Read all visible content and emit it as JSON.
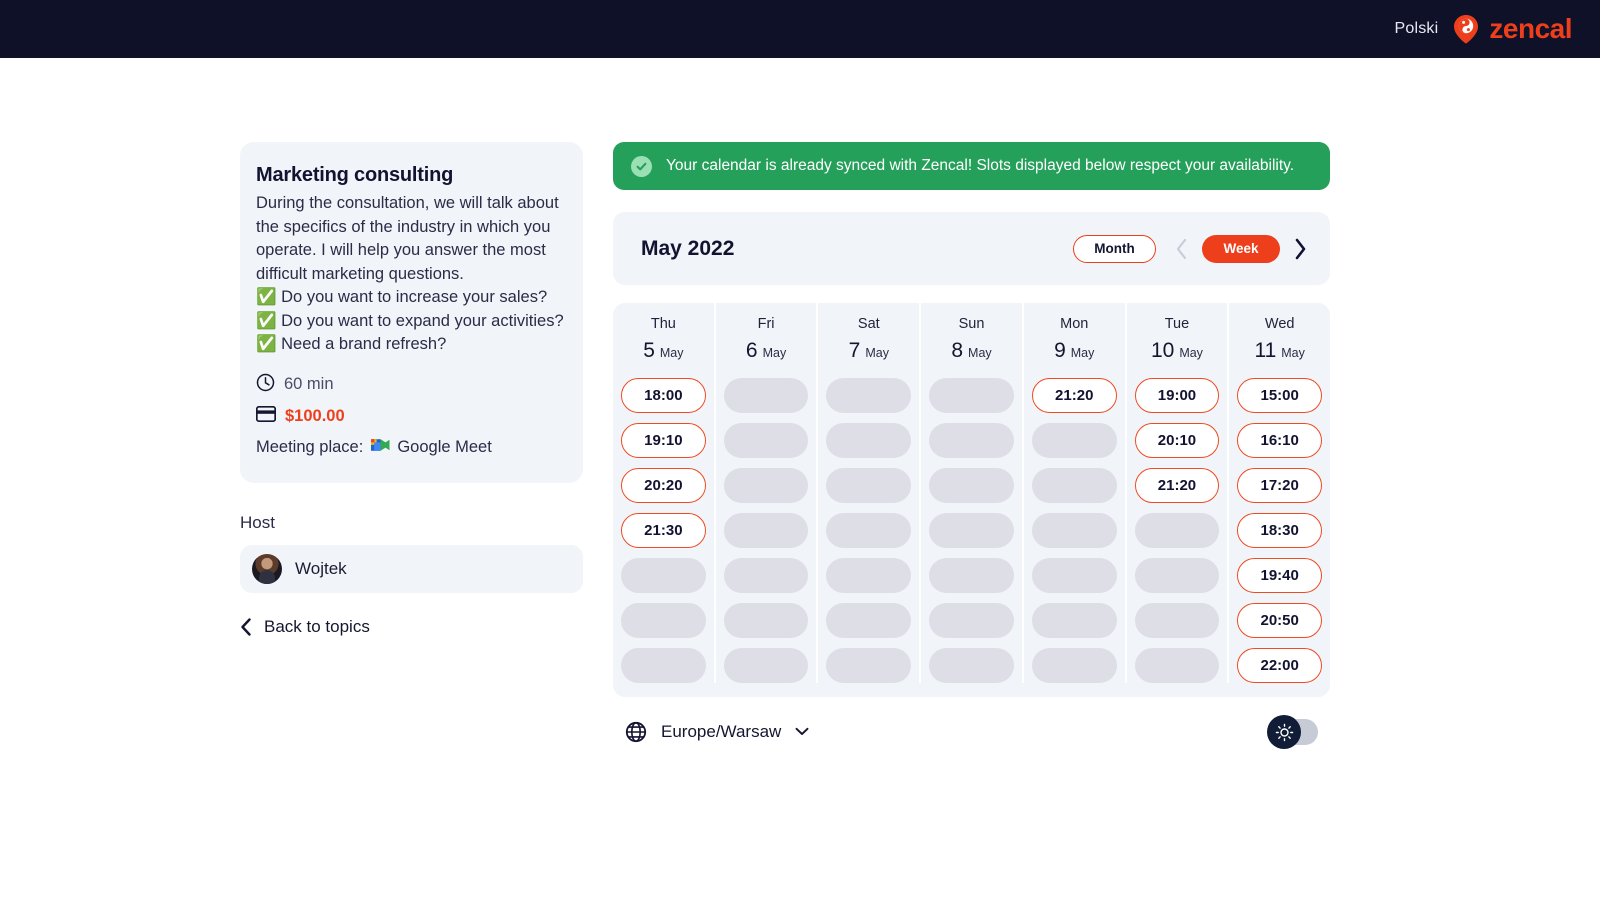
{
  "header": {
    "language": "Polski",
    "brand": "zencal",
    "brand_color": "#EE3F1C"
  },
  "event": {
    "title": "Marketing consulting",
    "description_paragraph": "During the consultation, we will talk about the specifics of the industry in which you operate. I will help you answer the most difficult marketing questions.",
    "bullets": [
      "Do you want to increase your sales?",
      "Do you want to expand your activities?",
      "Need a brand refresh?"
    ],
    "duration": "60 min",
    "price": "$100.00",
    "price_color": "#EE3F1C",
    "meeting_place_label": "Meeting place:",
    "meeting_place": "Google Meet"
  },
  "host": {
    "section_label": "Host",
    "name": "Wojtek"
  },
  "back_link": "Back to topics",
  "banner": {
    "text": "Your calendar is already synced with Zencal! Slots displayed below respect your availability.",
    "background": "#25A05A"
  },
  "calendar": {
    "title": "May 2022",
    "month_button": "Month",
    "week_button": "Week",
    "active_view": "Week",
    "days": [
      {
        "dow": "Thu",
        "num": "5",
        "month": "May",
        "slots": [
          "18:00",
          "19:10",
          "20:20",
          "21:30",
          "",
          "",
          ""
        ]
      },
      {
        "dow": "Fri",
        "num": "6",
        "month": "May",
        "slots": [
          "",
          "",
          "",
          "",
          "",
          "",
          ""
        ]
      },
      {
        "dow": "Sat",
        "num": "7",
        "month": "May",
        "slots": [
          "",
          "",
          "",
          "",
          "",
          "",
          ""
        ]
      },
      {
        "dow": "Sun",
        "num": "8",
        "month": "May",
        "slots": [
          "",
          "",
          "",
          "",
          "",
          "",
          ""
        ]
      },
      {
        "dow": "Mon",
        "num": "9",
        "month": "May",
        "slots": [
          "21:20",
          "",
          "",
          "",
          "",
          "",
          ""
        ]
      },
      {
        "dow": "Tue",
        "num": "10",
        "month": "May",
        "slots": [
          "19:00",
          "20:10",
          "21:20",
          "",
          "",
          "",
          ""
        ]
      },
      {
        "dow": "Wed",
        "num": "11",
        "month": "May",
        "slots": [
          "15:00",
          "16:10",
          "17:20",
          "18:30",
          "19:40",
          "20:50",
          "22:00"
        ]
      }
    ]
  },
  "footer": {
    "timezone": "Europe/Warsaw",
    "theme_mode": "light"
  }
}
